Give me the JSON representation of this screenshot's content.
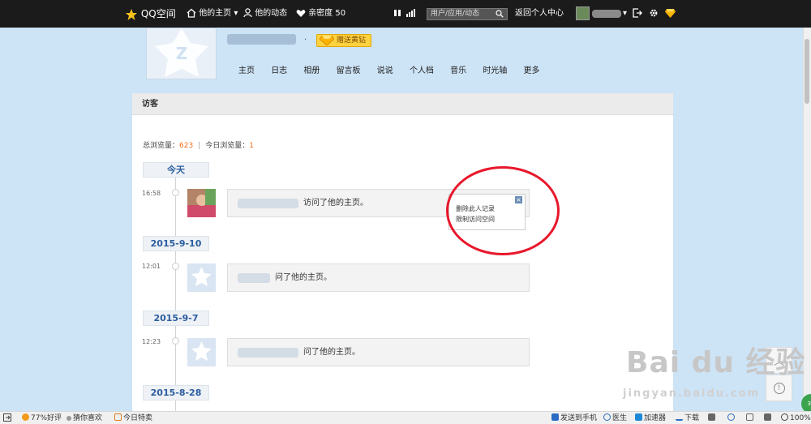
{
  "topbar": {
    "brand": "QQ空间",
    "home": "他的主页",
    "feed": "他的动态",
    "intimacy": "亲密度 50",
    "search_placeholder": "用户/应用/动态",
    "back_center": "返回个人中心"
  },
  "profile": {
    "gift_label": "赠送黄钻"
  },
  "nav": {
    "items": [
      "主页",
      "日志",
      "相册",
      "留言板",
      "说说",
      "个人档",
      "音乐",
      "时光轴",
      "更多"
    ]
  },
  "visitors": {
    "title": "访客",
    "total_label": "总浏览量：",
    "total_value": "623",
    "sep": "|",
    "today_label": "今日浏览量：",
    "today_value": "1",
    "groups": [
      {
        "date": "今天",
        "time": "16:58",
        "text": "访问了他的主页。"
      },
      {
        "date": "2015-9-10",
        "time": "12:01",
        "text": "问了他的主页。"
      },
      {
        "date": "2015-9-7",
        "time": "12:23",
        "text": "问了他的主页。"
      },
      {
        "date": "2015-8-28",
        "time": "",
        "text": ""
      }
    ],
    "menu": {
      "delete": "删除此人记录",
      "restrict": "限制访问空间",
      "close": "×"
    }
  },
  "side": {
    "up": "︿",
    "info": "!"
  },
  "watermark": {
    "text": "Bai du 经验",
    "url": "jingyan.baidu.com"
  },
  "badge": "33",
  "statusbar": {
    "rating": "77%好评",
    "guess": "猜你喜欢",
    "deals": "今日特卖",
    "send_phone": "发送到手机",
    "doctor": "医生",
    "accelerator": "加速器",
    "download": "下载",
    "zoom": "100%"
  },
  "colors": {
    "accent_orange": "#f46e1b",
    "date_blue": "#2a5d9f",
    "annotation_red": "#e8182c",
    "topbar_bg": "#1b1b1b"
  }
}
